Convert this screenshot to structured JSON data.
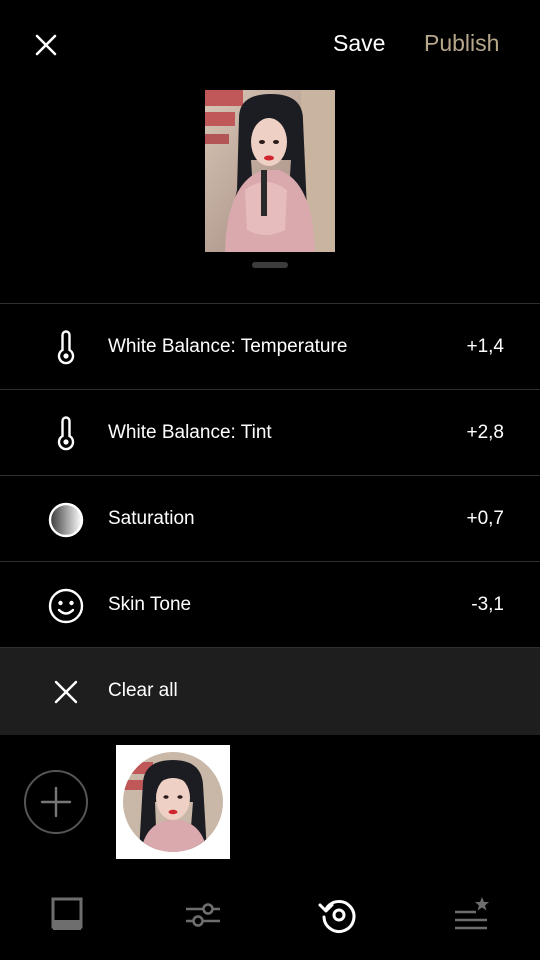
{
  "header": {
    "close_icon": "close-icon",
    "save_label": "Save",
    "publish_label": "Publish",
    "publish_color": "#b7a78b"
  },
  "adjustments": [
    {
      "icon": "thermometer-icon",
      "label": "White Balance: Temperature",
      "value": "+1,4"
    },
    {
      "icon": "thermometer-icon",
      "label": "White Balance: Tint",
      "value": "+2,8"
    },
    {
      "icon": "saturation-gradient-icon",
      "label": "Saturation",
      "value": "+0,7"
    },
    {
      "icon": "smiley-face-icon",
      "label": "Skin Tone",
      "value": "-3,1"
    }
  ],
  "clear_all": {
    "icon": "close-icon",
    "label": "Clear all"
  },
  "presets": {
    "add_icon": "plus-icon"
  },
  "tabbar": {
    "tabs": [
      {
        "icon": "frame-icon"
      },
      {
        "icon": "sliders-icon"
      },
      {
        "icon": "history-icon",
        "active": true
      },
      {
        "icon": "starred-list-icon"
      }
    ]
  }
}
